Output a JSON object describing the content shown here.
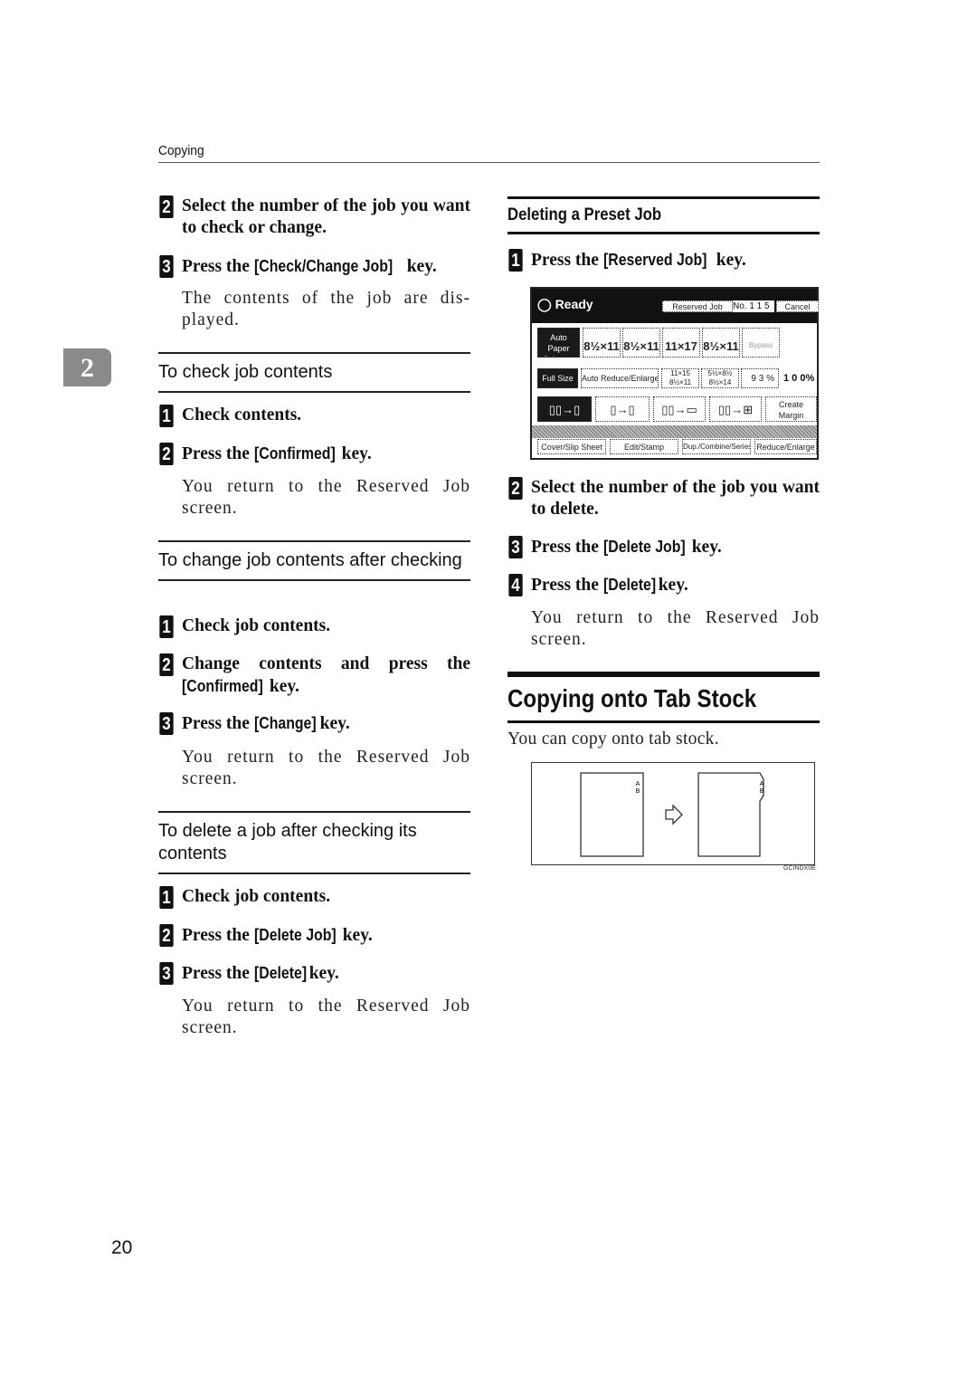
{
  "header": {
    "running_head": "Copying",
    "chapter_tab": "2"
  },
  "left_column": {
    "steps_top": [
      {
        "num": "2",
        "text": "Select the number of the job you want to check or change."
      },
      {
        "num": "3",
        "pre": "Press the ",
        "key": "[Check/Change Job]",
        "post": " key.",
        "note": "The contents of the job are dis-played."
      }
    ],
    "section_check": {
      "title": "To check job contents",
      "steps": [
        {
          "num": "1",
          "text": "Check contents."
        },
        {
          "num": "2",
          "pre": " Press the ",
          "key": "[Confirmed]",
          "post": " key.",
          "note": "You return to the Reserved Job screen."
        }
      ]
    },
    "section_change": {
      "title": "To change job contents after checking",
      "steps": [
        {
          "num": "1",
          "text": "Check job contents."
        },
        {
          "num": "2",
          "pre": "Change contents and press the ",
          "key": "[Confirmed]",
          "post": " key."
        },
        {
          "num": "3",
          "pre": "Press the ",
          "key": "[Change]",
          "post": " key.",
          "note": "You return to the Reserved Job screen."
        }
      ]
    },
    "section_delete": {
      "title": "To delete a job after checking its contents",
      "steps": [
        {
          "num": "1",
          "text": "Check job contents."
        },
        {
          "num": "2",
          "pre": "Press the ",
          "key": "[Delete Job]",
          "post": " key."
        },
        {
          "num": "3",
          "pre": "Press the ",
          "key": "[Delete]",
          "post": " key.",
          "note": "You return to the Reserved Job screen."
        }
      ]
    }
  },
  "right_column": {
    "subsection_title": "Deleting a Preset Job",
    "steps": [
      {
        "num": "1",
        "pre": "Press the ",
        "key": "[Reserved Job]",
        "post": " key."
      },
      {
        "num": "2",
        "text": "Select the number of the job you want to delete."
      },
      {
        "num": "3",
        "pre": "Press the ",
        "key": "[Delete Job]",
        "post": " key."
      },
      {
        "num": "4",
        "pre": "Press the ",
        "key": "[Delete]",
        "post": " key.",
        "note": "You return to the Reserved Job screen."
      }
    ],
    "section_title": "Copying onto Tab Stock",
    "section_intro": "You can copy onto tab stock.",
    "figure": {
      "label_a": "A",
      "label_b": "B",
      "code": "GCINDX0E"
    }
  },
  "copier_panel": {
    "status": "Ready",
    "reserved_job": "Reserved Job",
    "job_no": "No. 1 1 5",
    "cancel": "Cancel",
    "auto_paper": "Auto Paper Select ▶",
    "trays": [
      {
        "id": "1",
        "size": "8½×11"
      },
      {
        "id": "2",
        "size": "8½×11"
      },
      {
        "id": "3",
        "size": "11×17"
      },
      {
        "id": "T",
        "size": "8½×11"
      },
      {
        "id": "",
        "size": "Bypass"
      }
    ],
    "full_size": "Full Size",
    "auto_reduce": "Auto Reduce/Enlarge",
    "ratio_1": "11×15 8½×11",
    "ratio_2": "5½×8½ 8½×14",
    "zoom_pct": "9 3 %",
    "current_pct": "1 0 0%",
    "create_margin": "Create Margin",
    "tabs": [
      "Cover/Slip Sheet",
      "Edit/Stamp",
      "Dup./Combine/Series",
      "Reduce/Enlarge"
    ]
  },
  "footer": {
    "page_number": "20"
  }
}
